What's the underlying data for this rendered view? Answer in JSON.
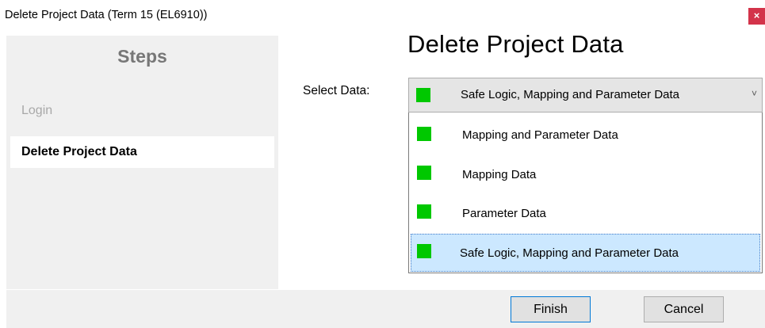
{
  "window": {
    "title": "Delete Project Data (Term 15 (EL6910))",
    "close_glyph": "×"
  },
  "steps": {
    "title": "Steps",
    "items": [
      {
        "label": "Login",
        "state": "disabled"
      },
      {
        "label": "Delete Project Data",
        "state": "active"
      }
    ]
  },
  "main": {
    "title": "Delete Project Data",
    "select_label": "Select Data:",
    "select": {
      "value": "Safe Logic, Mapping and Parameter Data",
      "chevron_glyph": "˅",
      "options": [
        "Mapping and Parameter Data",
        "Mapping Data",
        "Parameter Data",
        "Safe Logic, Mapping and Parameter Data"
      ],
      "selected_index": 3
    }
  },
  "footer": {
    "finish_label": "Finish",
    "cancel_label": "Cancel"
  },
  "colors": {
    "swatch": "#00c800",
    "close": "#d3334a",
    "highlight": "#cce8ff",
    "panel": "#f0f0f0"
  }
}
